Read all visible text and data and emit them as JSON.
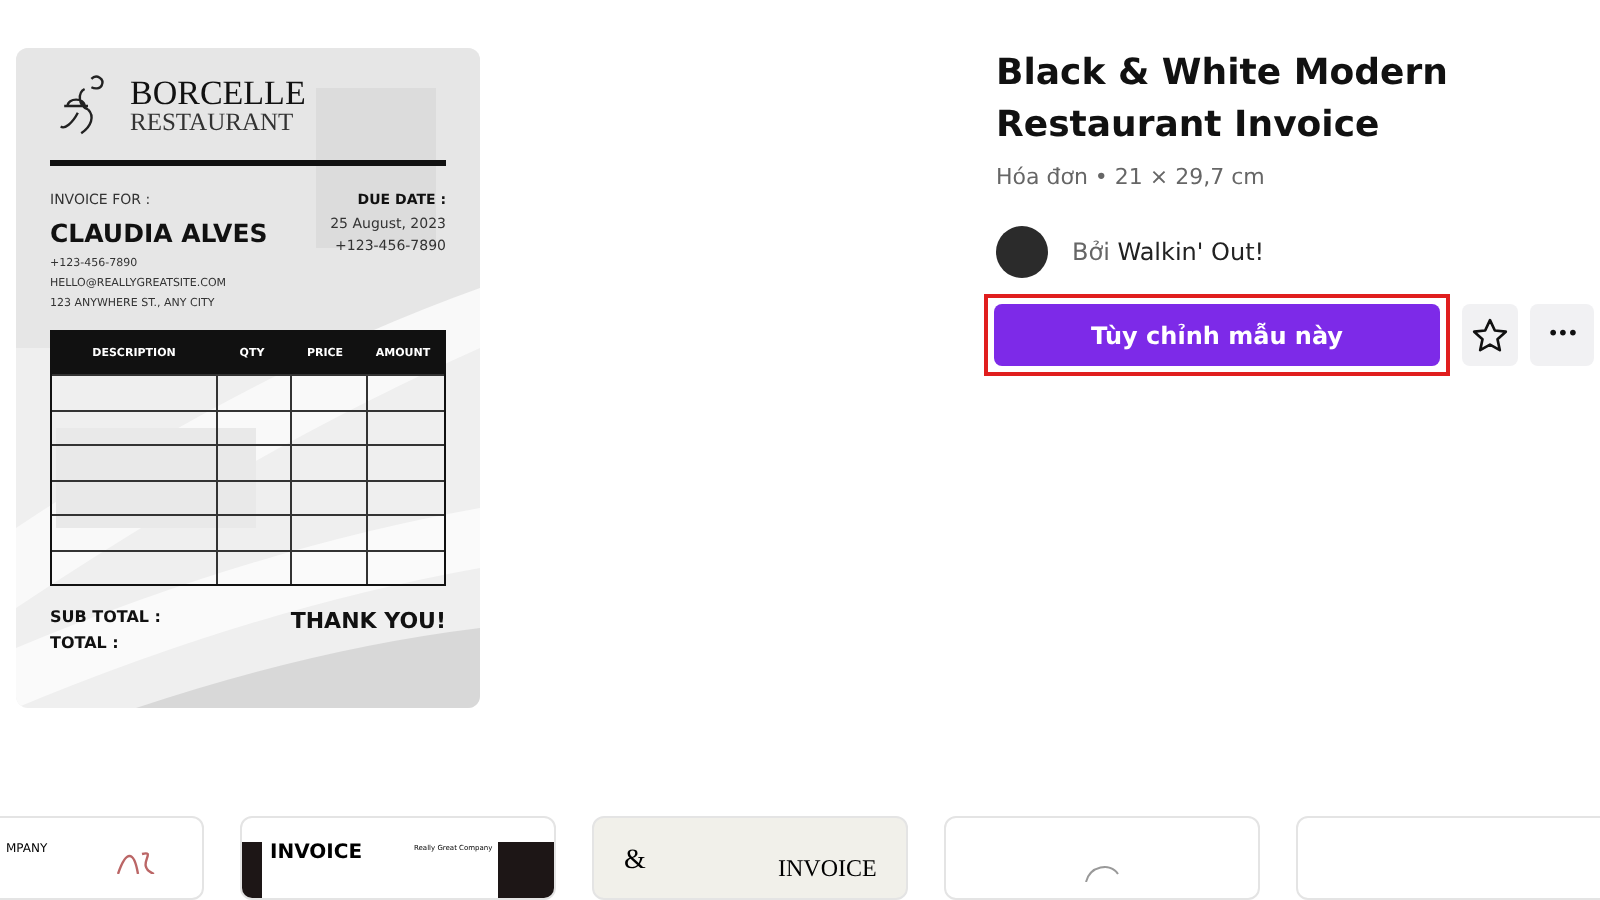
{
  "invoice": {
    "brand": "BORCELLE",
    "brand_sub": "RESTAURANT",
    "invoice_for_label": "INVOICE FOR :",
    "client": "CLAUDIA ALVES",
    "client_lines": [
      "+123-456-7890",
      "HELLO@REALLYGREATSITE.COM",
      "123 ANYWHERE ST., ANY CITY"
    ],
    "due_label": "DUE DATE :",
    "due_lines": [
      "25 August, 2023",
      "+123-456-7890"
    ],
    "columns": [
      "DESCRIPTION",
      "QTY",
      "PRICE",
      "AMOUNT"
    ],
    "rows": [
      {
        "kind": "blank"
      },
      {
        "kind": "blank"
      },
      {
        "kind": "blank"
      },
      {
        "kind": "blank"
      },
      {
        "kind": "blank"
      },
      {
        "kind": "blank"
      }
    ],
    "totals": [
      "SUB TOTAL :",
      "TOTAL :"
    ],
    "thanks": "THANK YOU!"
  },
  "details": {
    "title": "Black & White Modern Restaurant Invoice",
    "meta": "Hóa đơn • 21 × 29,7 cm",
    "by_prefix": "Bởi",
    "author": "Walkin' Out!",
    "primary_button": "Tùy chỉnh mẫu này",
    "highlighted": true,
    "more_button": "•••"
  },
  "thumbnails": [
    {
      "kind": "company",
      "text": "MPANY"
    },
    {
      "kind": "dark",
      "text": "INVOICE",
      "sub": "Really Great Company"
    },
    {
      "kind": "cream",
      "mark": "&",
      "text": "INVOICE"
    },
    {
      "kind": "plain"
    },
    {
      "kind": "plain"
    }
  ]
}
